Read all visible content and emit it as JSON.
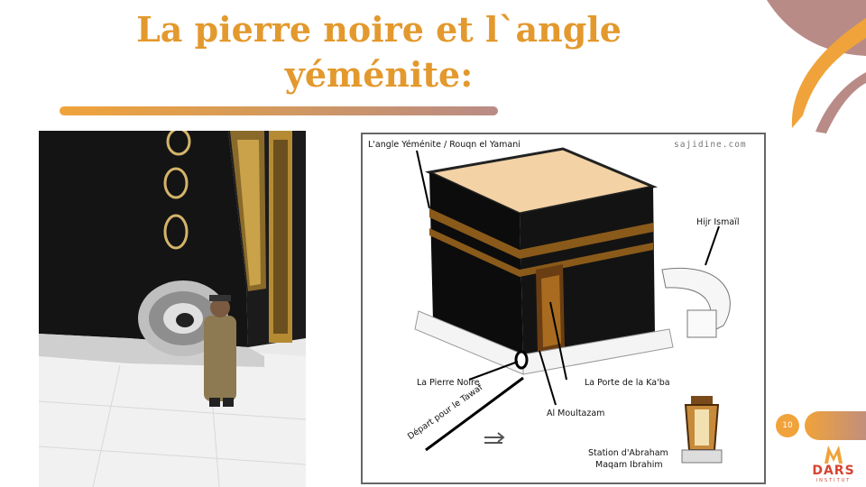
{
  "slide": {
    "title_line1": "La pierre noire et l`angle",
    "title_line2": "yéménite:",
    "page_number": "10"
  },
  "diagram": {
    "source": "sajidine.com",
    "labels": {
      "corner": "L'angle Yéménite / Rouqn el Yamani",
      "hijr": "Hijr Ismaïl",
      "black_stone": "La Pierre Noire",
      "door": "La Porte de la Ka'ba",
      "moultazam": "Al Moultazam",
      "tawaf_start": "Départ pour le Tawaf",
      "station_line1": "Station d'Abraham",
      "station_line2": "Maqam Ibrahim"
    }
  },
  "logo": {
    "name": "DARS",
    "sub": "INSTITUT"
  },
  "colors": {
    "accent": "#f0a33a",
    "mauve": "#b98b87",
    "title": "#e3992d"
  }
}
